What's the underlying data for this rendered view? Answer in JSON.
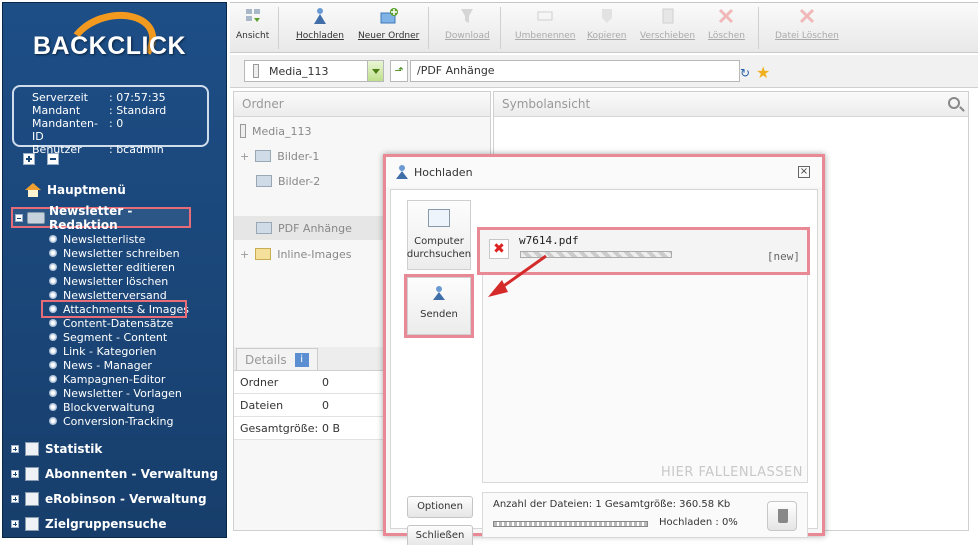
{
  "sidebar": {
    "logo": "BACKCLICK",
    "info": [
      {
        "key": "Serverzeit",
        "value": ": 07:57:35"
      },
      {
        "key": "Mandant",
        "value": ": Standard"
      },
      {
        "key": "Mandanten-ID",
        "value": ": 0"
      },
      {
        "key": "Benutzer",
        "value": ": bcadmin"
      }
    ],
    "main_menu": "Hauptmenü",
    "active_section": "Newsletter - Redaktion",
    "items": [
      "Newsletterliste",
      "Newsletter schreiben",
      "Newsletter editieren",
      "Newsletter löschen",
      "Newsletterversand",
      "Attachments & Images",
      "Content-Datensätze",
      "Segment - Content",
      "Link - Kategorien",
      "News - Manager",
      "Kampagnen-Editor",
      "Newsletter - Vorlagen",
      "Blockverwaltung",
      "Conversion-Tracking"
    ],
    "sections": [
      "Statistik",
      "Abonnenten - Verwaltung",
      "eRobinson - Verwaltung",
      "Zielgruppensuche"
    ]
  },
  "toolbar": {
    "ansicht": "Ansicht",
    "hochladen": "Hochladen",
    "neuer_ordner": "Neuer Ordner",
    "download": "Download",
    "umbenennen": "Umbenennen",
    "kopieren": "Kopieren",
    "verschieben": "Verschieben",
    "loeschen": "Löschen",
    "datei_loeschen": "Datei Löschen"
  },
  "pathbar": {
    "folder": "Media_113",
    "path": "/PDF Anhänge"
  },
  "left_panel": {
    "title": "Ordner",
    "root": "Media_113",
    "folders": [
      "Bilder-1",
      "Bilder-2",
      "PDF Anhänge",
      "Inline-Images"
    ],
    "details_tab": "Details",
    "details": [
      {
        "key": "Ordner",
        "value": "0"
      },
      {
        "key": "Dateien",
        "value": "0"
      },
      {
        "key": "Gesamtgröße:",
        "value": "0 B"
      }
    ]
  },
  "right_panel": {
    "title": "Symbolansicht"
  },
  "dialog": {
    "title": "Hochladen",
    "browse_label": "Computer durchsuchen",
    "send_label": "Senden",
    "file_name": "w7614.pdf",
    "file_state": "[new]",
    "drop_label": "HIER FALLENLASSEN",
    "options_label": "Optionen",
    "close_label": "Schließen",
    "summary": "Anzahl der Dateien: 1 Gesamtgröße: 360.58 Kb",
    "upload_status": "Hochladen : 0%",
    "upload_progress": 0
  },
  "colors": {
    "sidebar": "#1a4577",
    "highlight": "#e98996",
    "logo_accent": "#f29a1f"
  }
}
